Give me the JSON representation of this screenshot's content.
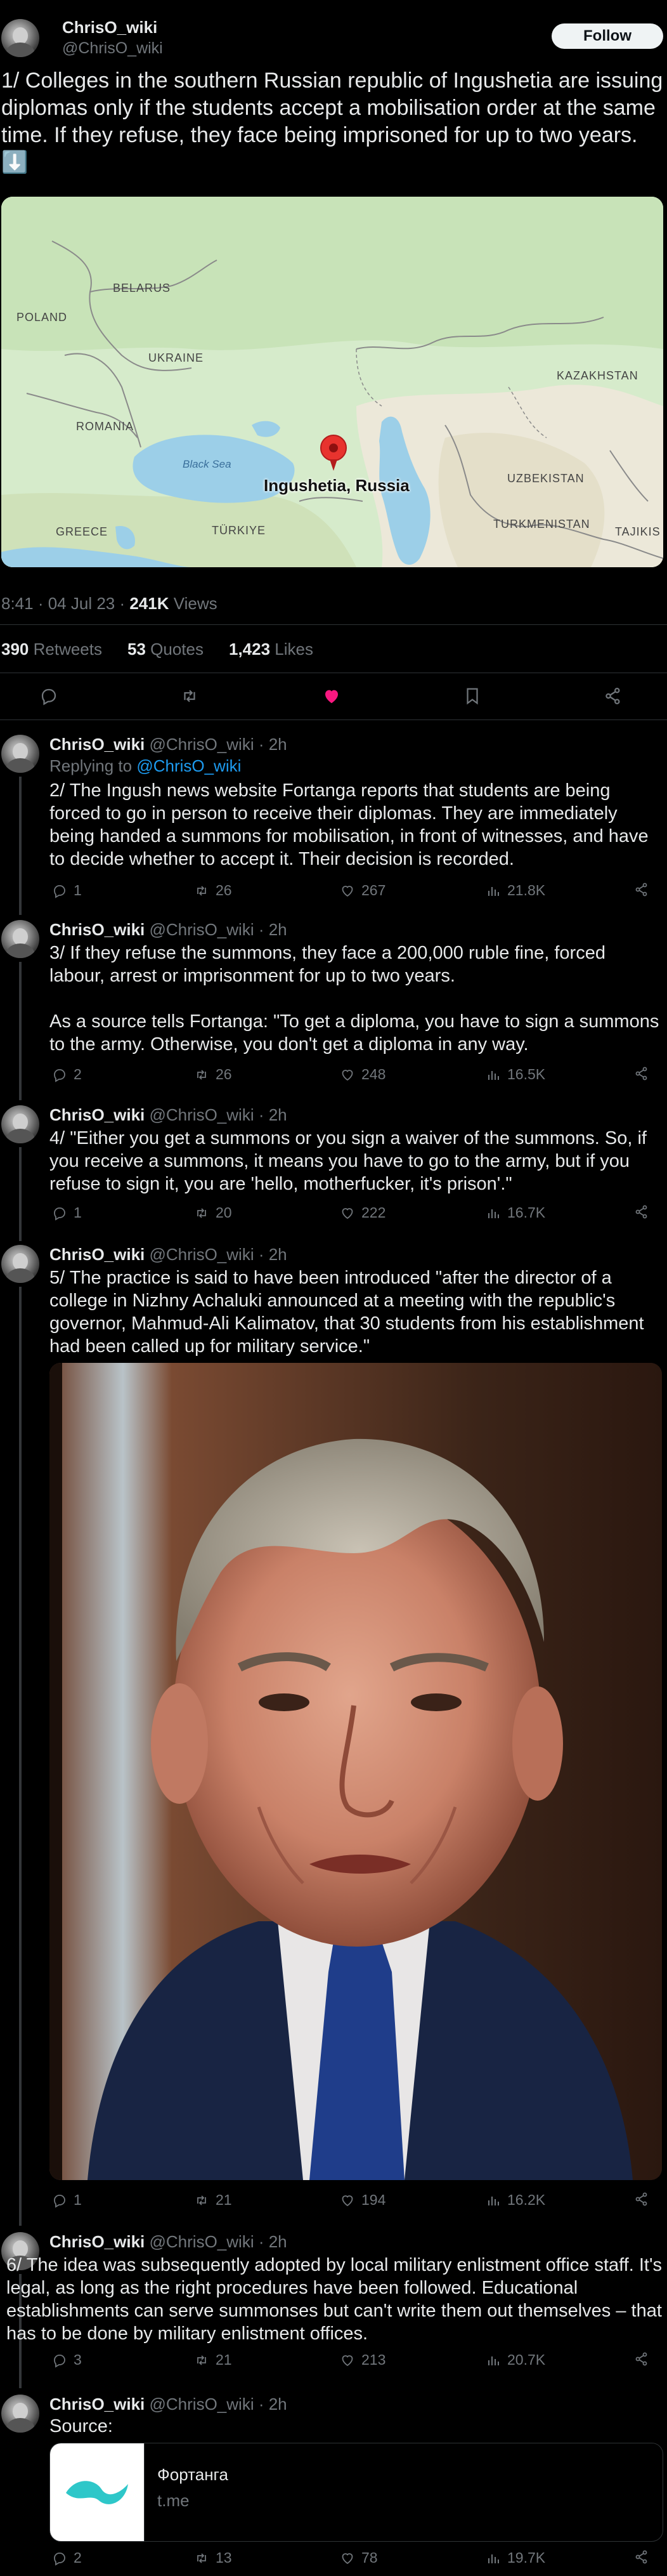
{
  "main_tweet": {
    "display_name": "ChrisO_wiki",
    "handle": "@ChrisO_wiki",
    "follow_label": "Follow",
    "text": "1/ Colleges in the southern Russian republic of Ingushetia are issuing diplomas only if the students accept a mobilisation order at the same time. If they refuse, they face being imprisoned for up to two years. ⬇️",
    "timestamp": "8:41 · 04 Jul 23 · ",
    "views_count": "241K",
    "views_label": " Views",
    "stats": {
      "retweets_count": "390",
      "retweets_label": " Retweets",
      "quotes_count": "53",
      "quotes_label": " Quotes",
      "likes_count": "1,423",
      "likes_label": " Likes"
    },
    "map": {
      "pin_label": "Ingushetia, Russia",
      "labels": {
        "belarus": "BELARUS",
        "poland": "POLAND",
        "ukraine": "UKRAINE",
        "romania": "ROMANIA",
        "black_sea": "Black Sea",
        "greece": "GREECE",
        "turkiye": "TÜRKIYE",
        "kazakhstan": "KAZAKHSTAN",
        "uzbekistan": "UZBEKISTAN",
        "turkmenistan": "TURKMENISTAN",
        "tajikistan": "TAJIKIS"
      }
    }
  },
  "replies": [
    {
      "display_name": "ChrisO_wiki",
      "meta": "@ChrisO_wiki · 2h",
      "replying_prefix": "Replying to ",
      "replying_handle": "@ChrisO_wiki",
      "text": "2/ The Ingush news website Fortanga reports that students are being forced to go in person to receive their diplomas. They are immediately being handed a summons for mobilisation, in front of witnesses, and have to decide whether to accept it. Their decision is recorded.",
      "replies": "1",
      "retweets": "26",
      "likes": "267",
      "views": "21.8K"
    },
    {
      "display_name": "ChrisO_wiki",
      "meta": "@ChrisO_wiki · 2h",
      "text": "3/ If they refuse the summons, they face a 200,000 ruble fine, forced labour, arrest or imprisonment for up to two years.",
      "text2": "As a source tells Fortanga: \"To get a diploma, you have to sign a summons to the army. Otherwise, you don't get a diploma in any way.",
      "replies": "2",
      "retweets": "26",
      "likes": "248",
      "views": "16.5K"
    },
    {
      "display_name": "ChrisO_wiki",
      "meta": "@ChrisO_wiki · 2h",
      "text": "4/ \"Either you get a summons or you sign a waiver of the summons. So, if you receive a summons, it means you have to go to the army, but if you refuse to sign it, you are 'hello, motherfucker, it's prison'.\"",
      "replies": "1",
      "retweets": "20",
      "likes": "222",
      "views": "16.7K"
    },
    {
      "display_name": "ChrisO_wiki",
      "meta": "@ChrisO_wiki · 2h",
      "text": "5/ The practice is said to have been introduced \"after the director of a college in Nizhny Achaluki announced at a meeting with the republic's governor, Mahmud-Ali Kalimatov, that 30 students from his establishment had been called up for military service.\"",
      "replies": "1",
      "retweets": "21",
      "likes": "194",
      "views": "16.2K"
    },
    {
      "display_name": "ChrisO_wiki",
      "meta": "@ChrisO_wiki · 2h",
      "text": "6/ The idea was subsequently adopted by local military enlistment office staff. It's legal, as long as the right procedures have been followed. Educational establishments can serve summonses but can't write them out themselves – that has to be done by military enlistment offices.",
      "replies": "3",
      "retweets": "21",
      "likes": "213",
      "views": "20.7K"
    },
    {
      "display_name": "ChrisO_wiki",
      "meta": "@ChrisO_wiki · 2h",
      "text": "Source:",
      "card_title": "Фортанга",
      "card_domain": "t.me",
      "replies": "2",
      "retweets": "13",
      "likes": "78",
      "views": "19.7K"
    }
  ],
  "colors": {
    "background": "#000000",
    "text": "#e7e9ea",
    "muted": "#71767b",
    "link": "#1d9bf0",
    "like_active": "#f91880",
    "card_accent": "#2ec7c9"
  },
  "icons": [
    "reply-icon",
    "retweet-icon",
    "like-icon",
    "bookmark-icon",
    "share-icon",
    "views-icon"
  ]
}
